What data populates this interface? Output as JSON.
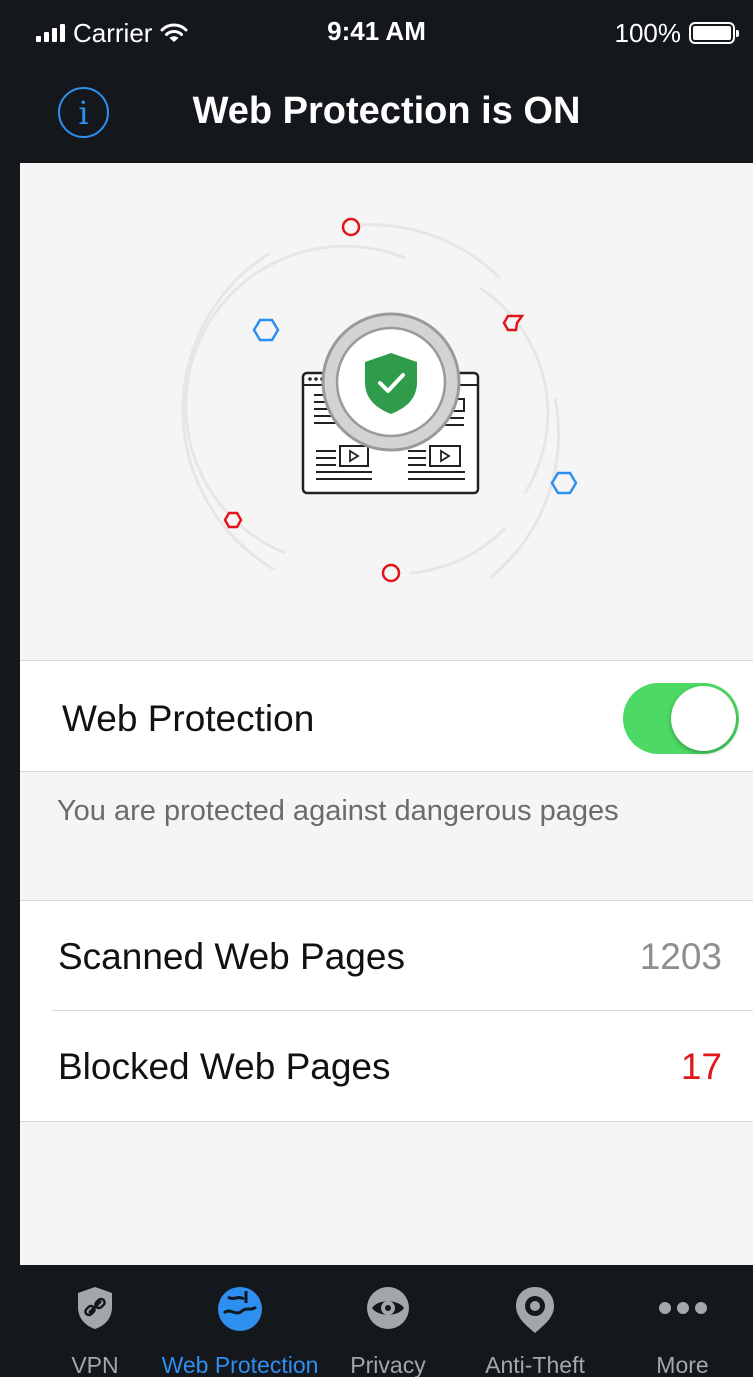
{
  "status_bar": {
    "carrier": "Carrier",
    "time": "9:41 AM",
    "battery": "100%"
  },
  "nav": {
    "title": "Web Protection is ON",
    "info_icon": "info-icon",
    "info_glyph": "i"
  },
  "toggle": {
    "label": "Web Protection",
    "enabled": true
  },
  "description": "You are protected against dangerous pages",
  "stats": [
    {
      "label": "Scanned Web Pages",
      "value": "1203"
    },
    {
      "label": "Blocked Web Pages",
      "value": "17"
    }
  ],
  "tabs": [
    {
      "label": "VPN",
      "icon": "shield-link-icon",
      "active": false
    },
    {
      "label": "Web Protection",
      "icon": "globe-shield-icon",
      "active": true
    },
    {
      "label": "Privacy",
      "icon": "eye-icon",
      "active": false
    },
    {
      "label": "Anti-Theft",
      "icon": "location-pin-icon",
      "active": false
    },
    {
      "label": "More",
      "icon": "more-dots-icon",
      "active": false
    }
  ],
  "colors": {
    "accent": "#2d8ff0",
    "toggle_on": "#4cd964",
    "danger": "#e0161b",
    "shield": "#2e9c4a",
    "bar_background": "#14171c"
  }
}
